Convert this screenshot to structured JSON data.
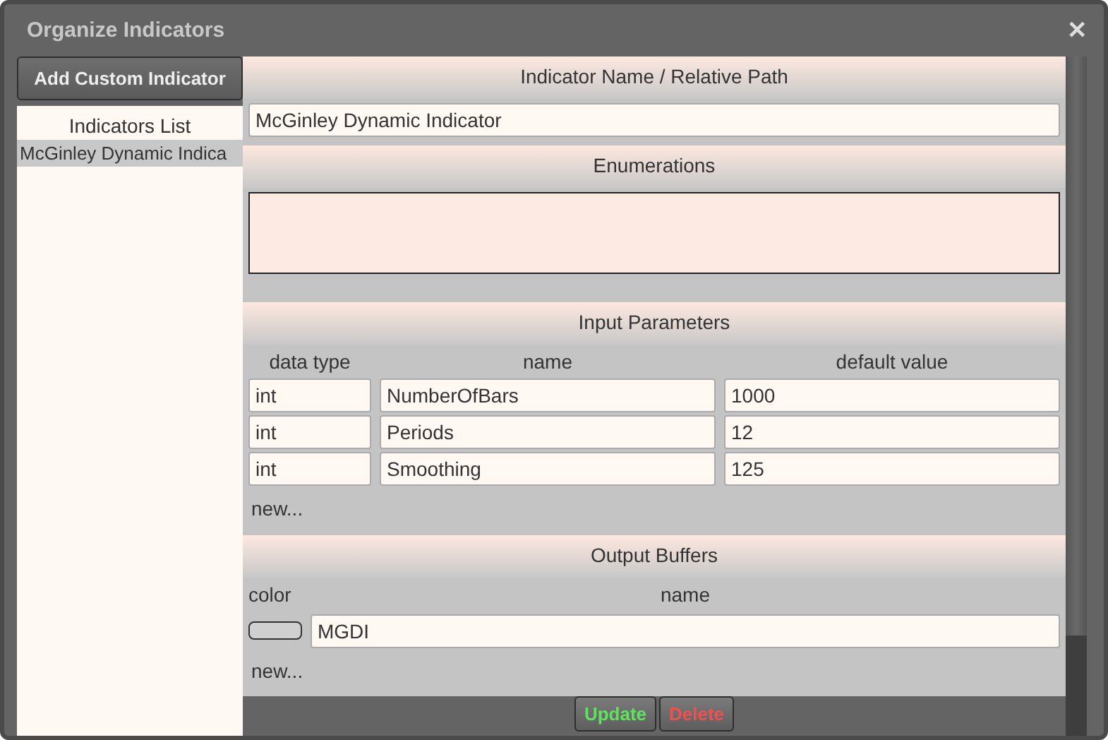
{
  "window": {
    "title": "Organize Indicators",
    "close": "✕"
  },
  "sidebar": {
    "add_button": "Add Custom Indicator",
    "list_title": "Indicators List",
    "items": [
      {
        "label": "McGinley Dynamic Indica",
        "selected": true
      }
    ]
  },
  "name_section": {
    "title": "Indicator Name / Relative Path",
    "value": "McGinley Dynamic Indicator"
  },
  "enumerations": {
    "title": "Enumerations"
  },
  "input_parameters": {
    "title": "Input Parameters",
    "columns": [
      "data type",
      "name",
      "default value"
    ],
    "rows": [
      {
        "type": "int",
        "name": "NumberOfBars",
        "default": "1000"
      },
      {
        "type": "int",
        "name": "Periods",
        "default": "12"
      },
      {
        "type": "int",
        "name": "Smoothing",
        "default": "125"
      }
    ],
    "new_link": "new..."
  },
  "output_buffers": {
    "title": "Output Buffers",
    "columns": [
      "color",
      "name"
    ],
    "rows": [
      {
        "color": "#d0d0d0",
        "name": "MGDI"
      }
    ],
    "new_link": "new..."
  },
  "buttons": [
    {
      "label": "Update",
      "kind": "confirm"
    },
    {
      "label": "Delete",
      "kind": "danger"
    }
  ]
}
